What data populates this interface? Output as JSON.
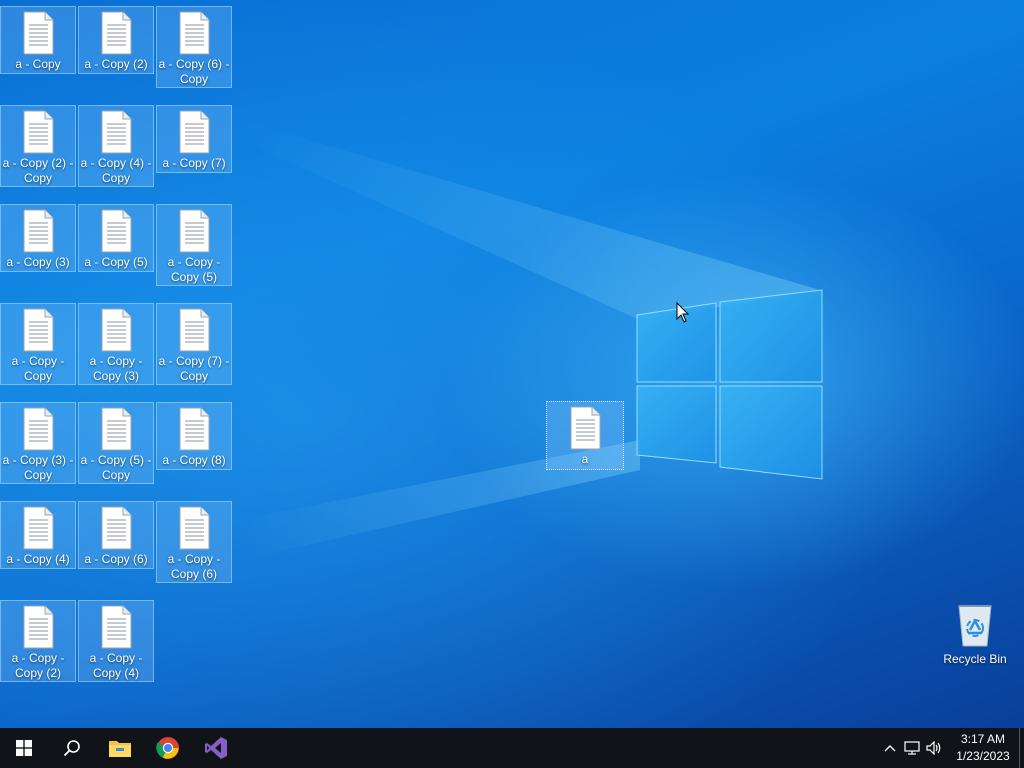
{
  "desktop": {
    "icons": [
      {
        "label": "a - Copy"
      },
      {
        "label": "a - Copy (2)"
      },
      {
        "label": "a - Copy (6) - Copy"
      },
      {
        "label": "a - Copy (2) - Copy"
      },
      {
        "label": "a - Copy (4) - Copy"
      },
      {
        "label": "a - Copy (7)"
      },
      {
        "label": "a - Copy (3)"
      },
      {
        "label": "a - Copy (5)"
      },
      {
        "label": "a - Copy - Copy (5)"
      },
      {
        "label": "a - Copy - Copy"
      },
      {
        "label": "a - Copy - Copy (3)"
      },
      {
        "label": "a - Copy (7) - Copy"
      },
      {
        "label": "a - Copy (3) - Copy"
      },
      {
        "label": "a - Copy (5) - Copy"
      },
      {
        "label": "a - Copy (8)"
      },
      {
        "label": "a - Copy (4)"
      },
      {
        "label": "a - Copy (6)"
      },
      {
        "label": "a - Copy - Copy (6)"
      },
      {
        "label": "a - Copy - Copy (2)"
      },
      {
        "label": "a - Copy - Copy (4)"
      }
    ],
    "dragged_icon": {
      "label": "a"
    },
    "recycle_bin": {
      "label": "Recycle Bin"
    }
  },
  "taskbar": {
    "pinned": [
      {
        "name": "start-icon"
      },
      {
        "name": "search-icon"
      },
      {
        "name": "file-explorer-icon"
      },
      {
        "name": "chrome-icon"
      },
      {
        "name": "visual-studio-icon"
      }
    ],
    "tray": {
      "chevron": "^",
      "network_icon": "network-icon",
      "volume_icon": "volume-icon"
    },
    "clock": {
      "time": "3:17 AM",
      "date": "1/23/2023"
    }
  },
  "colors": {
    "taskbar": "#101418",
    "desktop_blue": "#0b7fe0",
    "logo_glow": "#5cc8ff",
    "vs_purple": "#865fc5"
  }
}
